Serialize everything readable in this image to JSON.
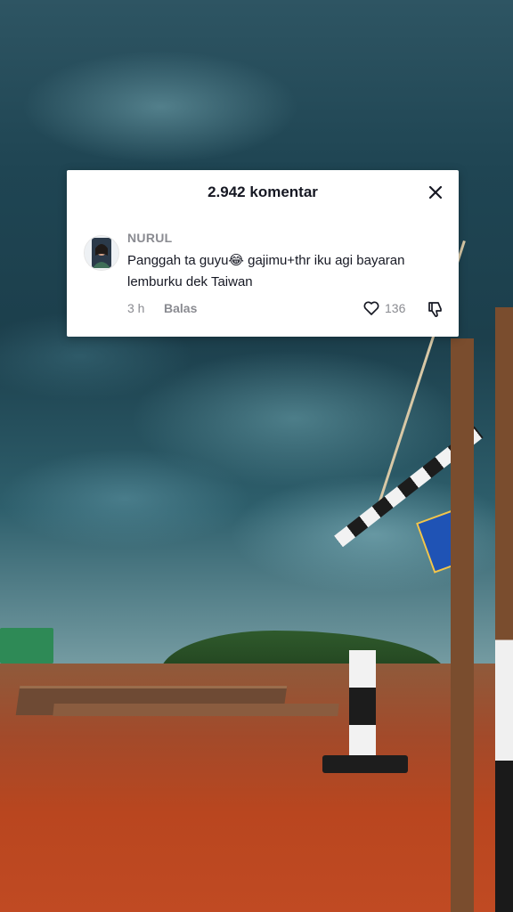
{
  "comments_panel": {
    "title": "2.942 komentar",
    "close_icon": "close-icon"
  },
  "comment": {
    "username": "NURUL",
    "text": "Panggah ta guyu😂 gajimu+thr iku agi bayaran lemburku dek Taiwan",
    "time": "3 h",
    "reply_label": "Balas",
    "like_count": "136",
    "like_icon": "heart-outline-icon",
    "dislike_icon": "thumbs-down-icon"
  },
  "colors": {
    "text_primary": "#161823",
    "text_secondary": "#8a8b91"
  }
}
